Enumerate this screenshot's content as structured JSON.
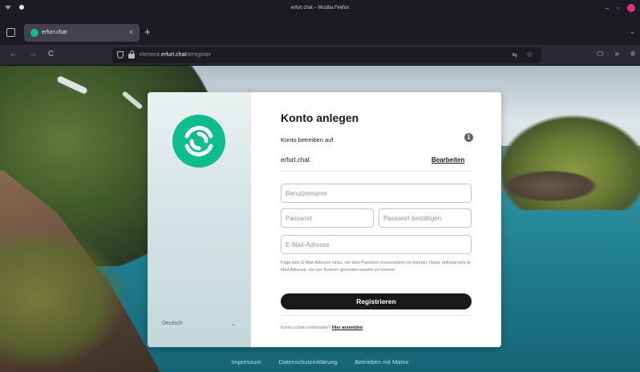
{
  "window": {
    "title": "erfurt.chat – Mozilla Firefox",
    "minimize_symbol": "–",
    "maximize_symbol": "▫"
  },
  "tabs": [
    {
      "label": "erfurt.chat",
      "active": true,
      "close_symbol": "×"
    }
  ],
  "tabstrip": {
    "new_tab_symbol": "+",
    "list_all_symbol": "⌄"
  },
  "navbar": {
    "back_symbol": "←",
    "forward_symbol": "→",
    "reload_symbol": "C",
    "url_prefix": "element.",
    "url_host": "erfurt.chat",
    "url_path": "/#/register",
    "translate_symbol": "⇆",
    "bookmark_symbol": "☆",
    "extensions_symbol": "⬭",
    "overflow_symbol": "»",
    "menu_symbol": "≡"
  },
  "dialog": {
    "language": "Deutsch",
    "language_caret": "⌄",
    "title": "Konto anlegen",
    "host_label": "Konto betreiben auf",
    "info_symbol": "i",
    "host": "erfurt.chat",
    "edit_label": "Bearbeiten",
    "username_placeholder": "Benutzername",
    "password_placeholder": "Passwort",
    "password_confirm_placeholder": "Passwort bestätigen",
    "email_placeholder": "E-Mail-Adresse",
    "hint": "Füge eine E-Mail-Adresse hinzu, um dein Passwort zurücksetzen zu können. Nutze optional eine E-Mail-Adresse, um von Nutzern gefunden werden zu können.",
    "register_label": "Registrieren",
    "login_prompt": "Konto schon vorhanden?",
    "login_link": "Hier anmelden"
  },
  "footer": {
    "imprint": "Impressum",
    "privacy": "Datenschutzerklärung",
    "powered_by": "Betrieben mit Matrix"
  },
  "colors": {
    "accent": "#0dbd8b",
    "button": "#17191c",
    "browser_chrome": "#1c1b22"
  }
}
